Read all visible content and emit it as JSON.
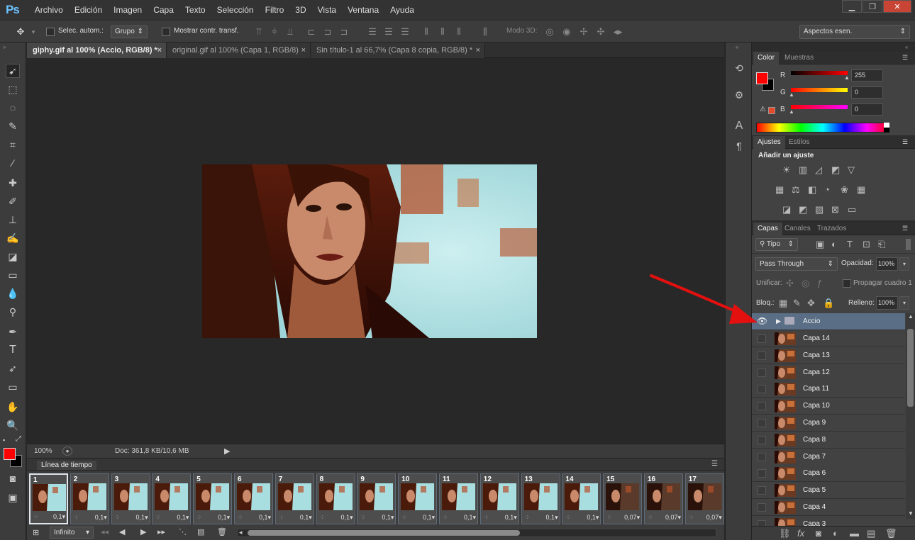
{
  "app": {
    "logo": "Ps",
    "accent": "#6dc2ff"
  },
  "menu": [
    "Archivo",
    "Edición",
    "Imagen",
    "Capa",
    "Texto",
    "Selección",
    "Filtro",
    "3D",
    "Vista",
    "Ventana",
    "Ayuda"
  ],
  "options": {
    "auto_select_label": "Selec. autom.:",
    "auto_select_target": "Grupo",
    "show_transform_label": "Mostrar contr. transf.",
    "mode3d_label": "Modo 3D:",
    "workspace": "Aspectos esen."
  },
  "tabs": [
    {
      "label": "giphy.gif al 100% (Accio, RGB/8) *",
      "active": true
    },
    {
      "label": "original.gif al 100% (Capa 1, RGB/8)",
      "active": false
    },
    {
      "label": "Sin título-1 al 66,7% (Capa 8 copia, RGB/8) *",
      "active": false
    }
  ],
  "status": {
    "zoom": "100%",
    "doc": "Doc: 361,8 KB/10,6 MB"
  },
  "timeline": {
    "title": "Línea de tiempo",
    "loop": "Infinito",
    "frames": [
      {
        "num": "1",
        "delay": "0,1"
      },
      {
        "num": "2",
        "delay": "0,1"
      },
      {
        "num": "3",
        "delay": "0,1"
      },
      {
        "num": "4",
        "delay": "0,1"
      },
      {
        "num": "5",
        "delay": "0,1"
      },
      {
        "num": "6",
        "delay": "0,1"
      },
      {
        "num": "7",
        "delay": "0,1"
      },
      {
        "num": "8",
        "delay": "0,1"
      },
      {
        "num": "9",
        "delay": "0,1"
      },
      {
        "num": "10",
        "delay": "0,1"
      },
      {
        "num": "11",
        "delay": "0,1"
      },
      {
        "num": "12",
        "delay": "0,1"
      },
      {
        "num": "13",
        "delay": "0,1"
      },
      {
        "num": "14",
        "delay": "0,1"
      },
      {
        "num": "15",
        "delay": "0,07"
      },
      {
        "num": "16",
        "delay": "0,07"
      },
      {
        "num": "17",
        "delay": "0,07"
      }
    ]
  },
  "color_panel": {
    "tabs": [
      "Color",
      "Muestras"
    ],
    "r_label": "R",
    "g_label": "G",
    "b_label": "B",
    "r": "255",
    "g": "0",
    "b": "0",
    "fg": "#ff0000",
    "bg": "#000000"
  },
  "adjust_panel": {
    "tabs": [
      "Ajustes",
      "Estilos"
    ],
    "title": "Añadir un ajuste"
  },
  "layers_panel": {
    "tabs": [
      "Capas",
      "Canales",
      "Trazados"
    ],
    "filter": "Tipo",
    "blend": "Pass Through",
    "opacity_label": "Opacidad:",
    "opacity": "100%",
    "unify_label": "Unificar:",
    "propagate_label": "Propagar cuadro 1",
    "lock_label": "Bloq.:",
    "fill_label": "Relleno:",
    "fill": "100%",
    "group": "Accio",
    "layers": [
      "Capa 14",
      "Capa 13",
      "Capa 12",
      "Capa 11",
      "Capa 10",
      "Capa 9",
      "Capa 8",
      "Capa 7",
      "Capa 6",
      "Capa 5",
      "Capa 4",
      "Capa 3"
    ]
  }
}
